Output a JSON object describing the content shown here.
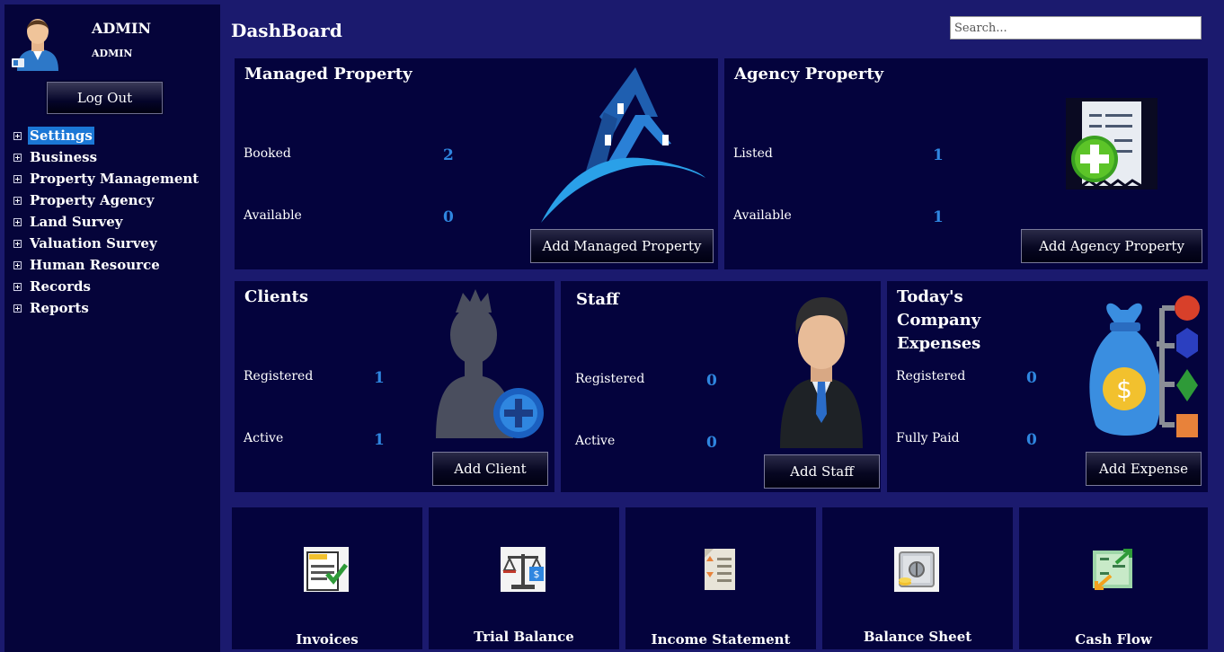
{
  "user": {
    "name": "ADMIN",
    "role": "ADMIN",
    "logout_label": "Log Out"
  },
  "menu": [
    {
      "label": "Settings",
      "selected": true
    },
    {
      "label": "Business"
    },
    {
      "label": "Property Management"
    },
    {
      "label": "Property Agency"
    },
    {
      "label": "Land Survey"
    },
    {
      "label": "Valuation Survey"
    },
    {
      "label": "Human Resource"
    },
    {
      "label": "Records"
    },
    {
      "label": "Reports"
    }
  ],
  "header": {
    "title": "DashBoard",
    "search_placeholder": "Search..."
  },
  "cards": {
    "managed": {
      "title": "Managed Property",
      "label1": "Booked",
      "value1": "2",
      "label2": "Available",
      "value2": "0",
      "button": "Add Managed Property"
    },
    "agency": {
      "title": "Agency Property",
      "label1": "Listed",
      "value1": "1",
      "label2": "Available",
      "value2": "1",
      "button": "Add Agency Property"
    },
    "clients": {
      "title": "Clients",
      "label1": "Registered",
      "value1": "1",
      "label2": "Active",
      "value2": "1",
      "button": "Add Client"
    },
    "staff": {
      "title": "Staff",
      "label1": "Registered",
      "value1": "0",
      "label2": "Active",
      "value2": "0",
      "button": "Add Staff"
    },
    "expenses": {
      "title": "Today's Company Expenses",
      "label1": "Registered",
      "value1": "0",
      "label2": "Fully Paid",
      "value2": "0",
      "button": "Add Expense"
    }
  },
  "reports": [
    {
      "label": "Invoices",
      "icon": "invoice-icon"
    },
    {
      "label": "Trial Balance",
      "icon": "scale-icon"
    },
    {
      "label": "Income Statement",
      "icon": "statement-icon"
    },
    {
      "label": "Balance Sheet",
      "icon": "safe-icon"
    },
    {
      "label": "Cash Flow",
      "icon": "cash-flow-icon"
    }
  ],
  "colors": {
    "background": "#1b1a6e",
    "panel": "#04033d",
    "accent": "#2f86e0",
    "selected": "#1b77d6"
  }
}
